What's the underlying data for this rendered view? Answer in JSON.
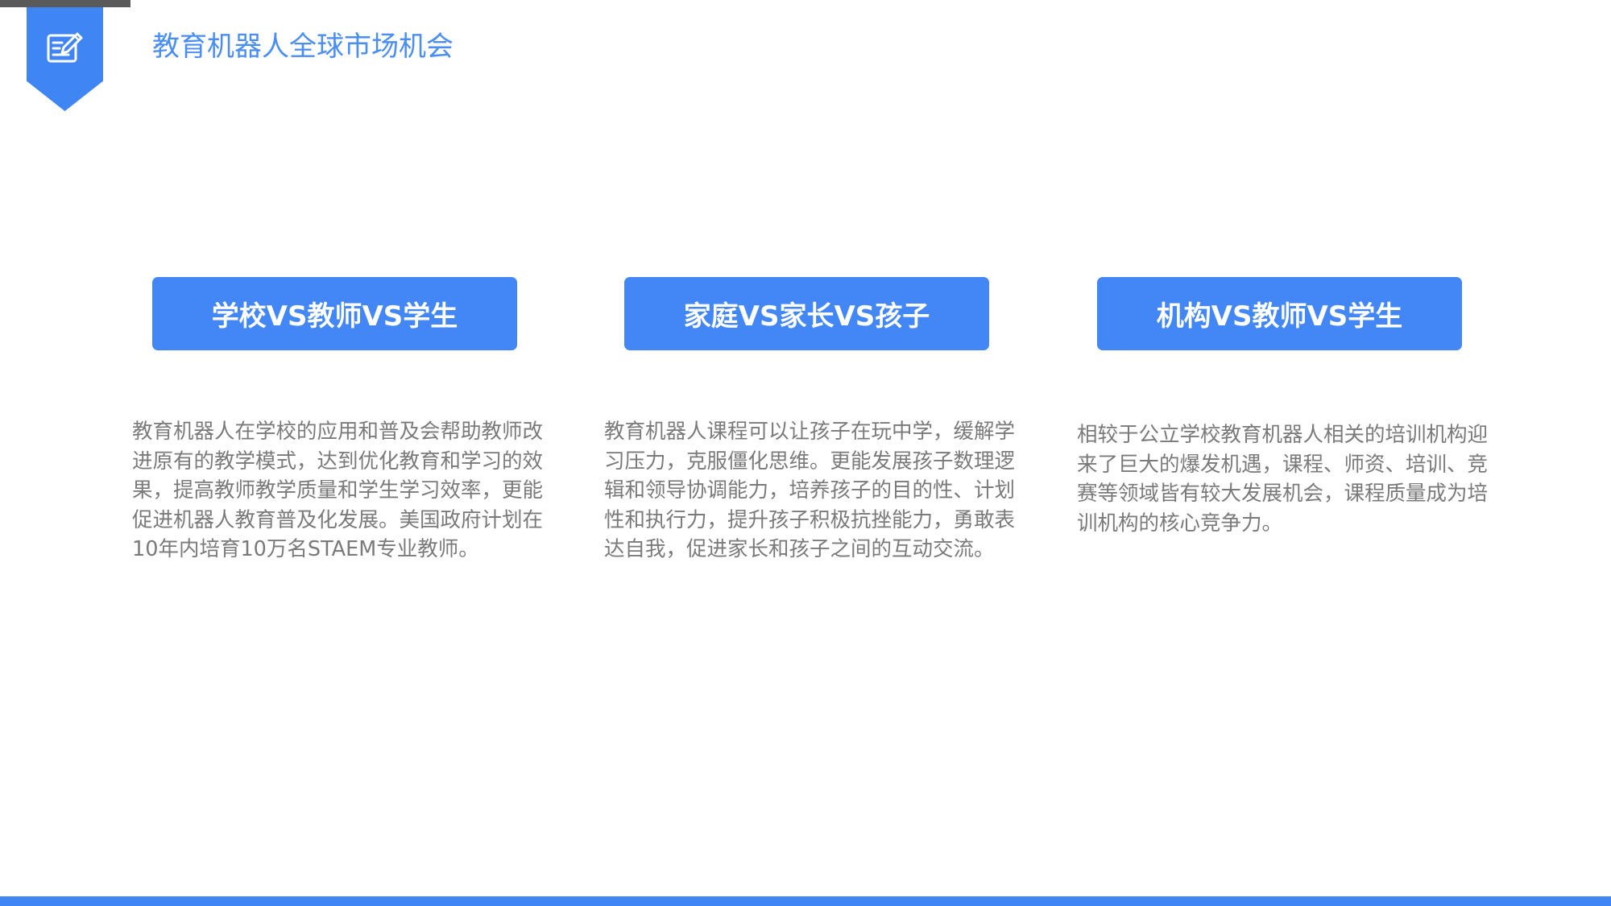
{
  "header": {
    "title": "教育机器人全球市场机会",
    "badge_icon": "edit-document-icon"
  },
  "cards": [
    {
      "title": "学校VS教师VS学生",
      "text": "教育机器人在学校的应用和普及会帮助教师改进原有的教学模式，达到优化教育和学习的效果，提高教师教学质量和学生学习效率，更能促进机器人教育普及化发展。美国政府计划在10年内培育10万名STAEM专业教师。"
    },
    {
      "title": "家庭VS家长VS孩子",
      "text": "教育机器人课程可以让孩子在玩中学，缓解学习压力，克服僵化思维。更能发展孩子数理逻辑和领导协调能力，培养孩子的目的性、计划性和执行力，提升孩子积极抗挫能力，勇敢表达自我，促进家长和孩子之间的互动交流。"
    },
    {
      "title": "机构VS教师VS学生",
      "text": "相较于公立学校教育机器人相关的培训机构迎来了巨大的爆发机遇，课程、师资、培训、竞赛等领域皆有较大发展机会，课程质量成为培训机构的核心竞争力。"
    }
  ],
  "colors": {
    "accent": "#3f86f4",
    "card_header": "#4287f5",
    "title": "#4a8ef5",
    "body_text": "#7a7a7a",
    "top_bar": "#5a5a5a"
  }
}
